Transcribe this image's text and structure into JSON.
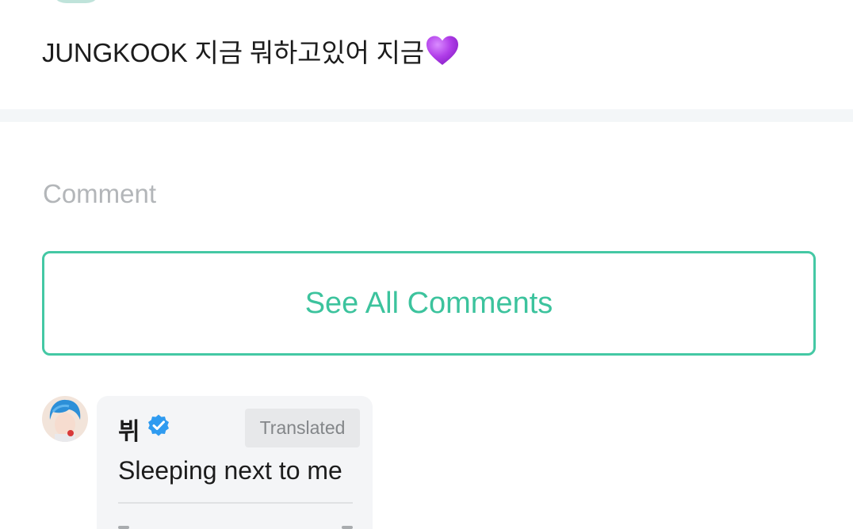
{
  "post": {
    "text": "JUNGKOOK 지금 뭐하고있어 지금"
  },
  "comments_section": {
    "heading": "Comment",
    "see_all_label": "See All Comments"
  },
  "comment": {
    "author": "뷔",
    "badge": "Translated",
    "text": "Sleeping next to me"
  },
  "colors": {
    "accent": "#44c8a4",
    "heart": "#b43ee8",
    "verified": "#2f9bf0"
  },
  "icons": [
    "purple-heart-icon",
    "verified-badge-icon"
  ]
}
